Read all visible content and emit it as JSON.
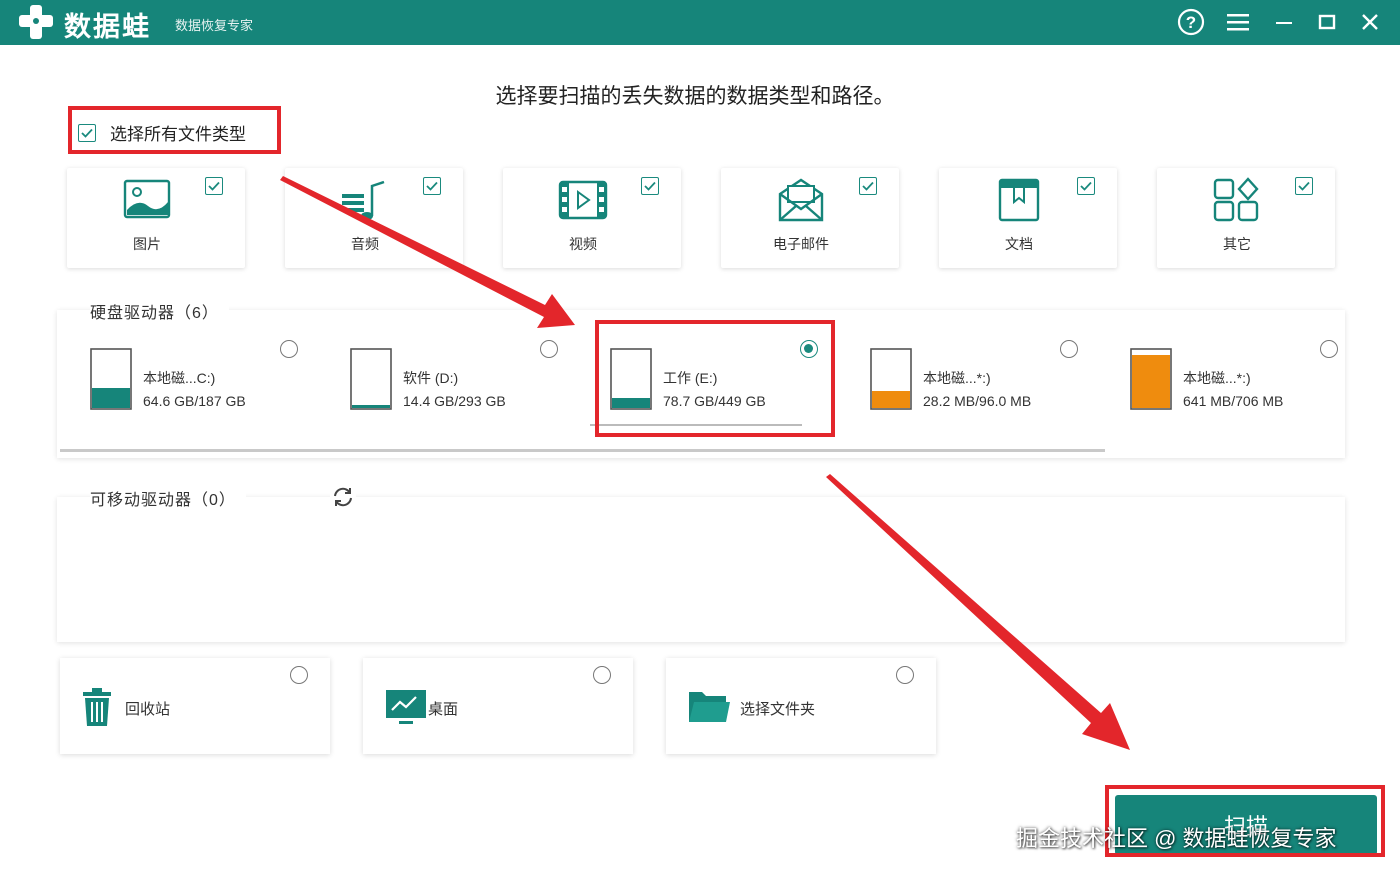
{
  "app": {
    "name": "数据蛙",
    "subtitle": "数据恢复专家"
  },
  "window_controls": [
    "help-icon",
    "menu-icon",
    "minimize-icon",
    "maximize-icon",
    "close-icon"
  ],
  "prompt": "选择要扫描的丢失数据的数据类型和路径。",
  "select_all": {
    "label": "选择所有文件类型",
    "checked": true
  },
  "file_types": [
    {
      "label": "图片",
      "icon": "image-icon",
      "checked": true
    },
    {
      "label": "音频",
      "icon": "audio-icon",
      "checked": true
    },
    {
      "label": "视频",
      "icon": "video-icon",
      "checked": true
    },
    {
      "label": "电子邮件",
      "icon": "email-icon",
      "checked": true
    },
    {
      "label": "文档",
      "icon": "document-icon",
      "checked": true
    },
    {
      "label": "其它",
      "icon": "other-icon",
      "checked": true
    }
  ],
  "hard_drives": {
    "title": "硬盘驱动器（6）",
    "items": [
      {
        "name": "本地磁...C:)",
        "size": "64.6 GB/187 GB",
        "fill_fraction": 0.35,
        "color": "#16857a",
        "selected": false
      },
      {
        "name": "软件 (D:)",
        "size": "14.4 GB/293 GB",
        "fill_fraction": 0.05,
        "color": "#16857a",
        "selected": false
      },
      {
        "name": "工作 (E:)",
        "size": "78.7 GB/449 GB",
        "fill_fraction": 0.18,
        "color": "#16857a",
        "selected": true
      },
      {
        "name": "本地磁...*:)",
        "size": "28.2 MB/96.0 MB",
        "fill_fraction": 0.29,
        "color": "#ef8c0e",
        "selected": false
      },
      {
        "name": "本地磁...*:)",
        "size": "641 MB/706 MB",
        "fill_fraction": 0.91,
        "color": "#ef8c0e",
        "selected": false
      }
    ]
  },
  "removable": {
    "title": "可移动驱动器（0）",
    "refresh_icon": "refresh-icon"
  },
  "locations": [
    {
      "label": "回收站",
      "icon": "trash-icon",
      "selected": false
    },
    {
      "label": "桌面",
      "icon": "desktop-icon",
      "selected": false
    },
    {
      "label": "选择文件夹",
      "icon": "folder-icon",
      "selected": false
    }
  ],
  "scan_button": "扫描",
  "watermark": "掘金技术社区 @ 数据蛙恢复专家",
  "colors": {
    "accent": "#16857a",
    "warning": "#ef8c0e",
    "annotation": "#e3262b"
  }
}
